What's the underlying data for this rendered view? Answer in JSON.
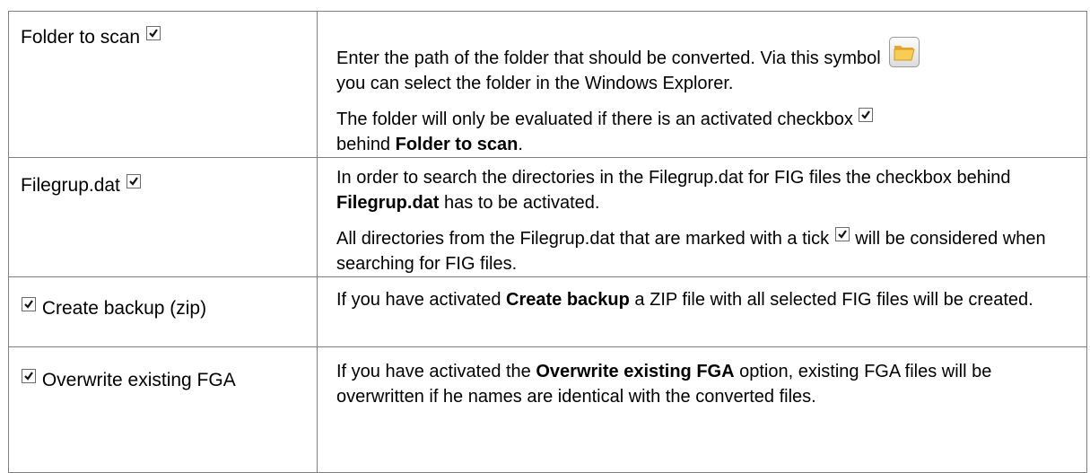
{
  "rows": [
    {
      "label": "Folder to scan",
      "p1_text_a": "Enter the path of the folder that should be converted. Via this symbol",
      "p1_text_b": "you can select the folder in the Windows Explorer.",
      "p2_text_a": "The folder will only be evaluated if there is an activated checkbox",
      "p2_text_b": "behind",
      "p2_bold": "Folder to scan",
      "p2_end": "."
    },
    {
      "label": "Filegrup.dat",
      "p1_text_a": "In order to search the directories in the Filegrup.dat for FIG files the checkbox behind",
      "p1_bold": "Filegrup.dat",
      "p1_text_b": "has to be activated.",
      "p2_text_a": "All directories from the Filegrup.dat that are marked with a tick",
      "p2_text_b": "will be considered when searching for FIG files."
    },
    {
      "label": "Create backup (zip)",
      "text_a": "If you have activated",
      "bold": "Create backup",
      "text_b": "a ZIP file with all selected FIG files will be created."
    },
    {
      "label": "Overwrite existing FGA",
      "text_a": "If you have activated the",
      "bold": "Overwrite existing FGA",
      "text_b": "option, existing FGA files will be overwritten if he names are identical with the converted files."
    }
  ],
  "icons": {
    "checkbox": "checkbox-checked-icon",
    "folder": "folder-open-icon"
  }
}
